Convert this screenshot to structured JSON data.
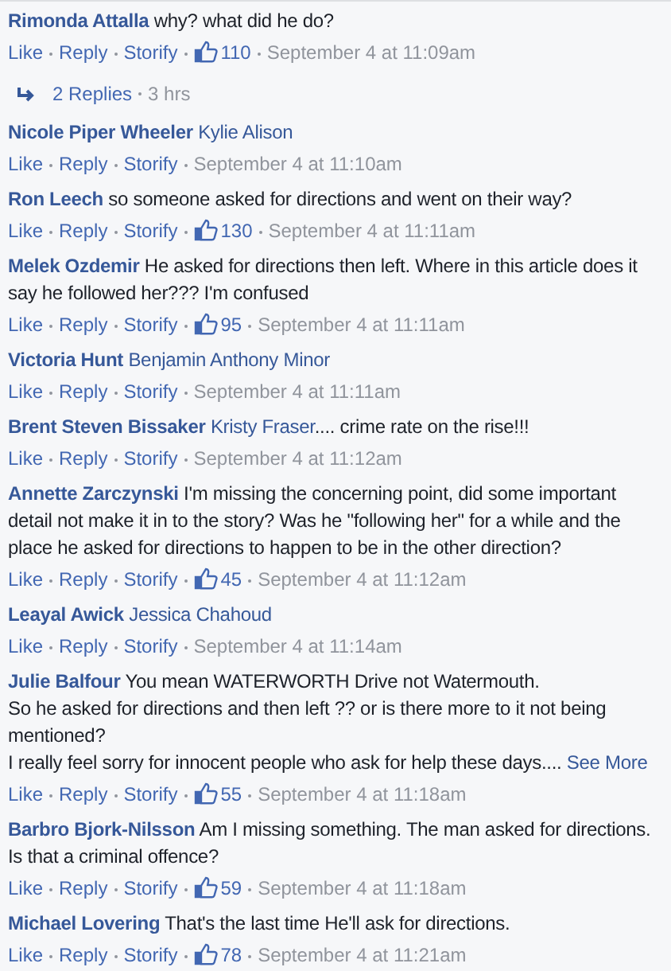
{
  "comments": [
    {
      "author": "Rimonda Attalla",
      "lines": [
        "why? what did he do?"
      ],
      "actions": [
        "Like",
        "Reply",
        "Storify"
      ],
      "likes": "110",
      "time": "September 4 at 11:09am",
      "replies": {
        "label": "2 Replies",
        "age": "3 hrs"
      }
    },
    {
      "author": "Nicole Piper Wheeler",
      "tag": "Kylie Alison",
      "actions": [
        "Like",
        "Reply",
        "Storify"
      ],
      "time": "September 4 at 11:10am"
    },
    {
      "author": "Ron Leech",
      "lines": [
        "so someone asked for directions and went on their way?"
      ],
      "actions": [
        "Like",
        "Reply",
        "Storify"
      ],
      "likes": "130",
      "time": "September 4 at 11:11am"
    },
    {
      "author": "Melek Ozdemir",
      "lines": [
        "He asked for directions then left. Where in this article does it say he followed her??? I'm confused"
      ],
      "actions": [
        "Like",
        "Reply",
        "Storify"
      ],
      "likes": "95",
      "time": "September 4 at 11:11am"
    },
    {
      "author": "Victoria Hunt",
      "tag": "Benjamin Anthony Minor",
      "actions": [
        "Like",
        "Reply",
        "Storify"
      ],
      "time": "September 4 at 11:11am"
    },
    {
      "author": "Brent Steven Bissaker",
      "tag": "Kristy Fraser",
      "lines": ".... crime rate on the rise!!!",
      "actions": [
        "Like",
        "Reply",
        "Storify"
      ],
      "time": "September 4 at 11:12am"
    },
    {
      "author": "Annette Zarczynski",
      "lines": [
        "I'm missing the concerning point, did some important detail not make it in to the story? Was he \"following her\" for a while and the place he asked for directions to happen to be in the other direction?"
      ],
      "actions": [
        "Like",
        "Reply",
        "Storify"
      ],
      "likes": "45",
      "time": "September 4 at 11:12am"
    },
    {
      "author": "Leayal Awick",
      "tag": "Jessica Chahoud",
      "actions": [
        "Like",
        "Reply",
        "Storify"
      ],
      "time": "September 4 at 11:14am"
    },
    {
      "author": "Julie Balfour",
      "lines": [
        "You mean WATERWORTH Drive not Watermouth.",
        "So he asked for directions and then left ?? or is there more to it not being mentioned?",
        "I really feel sorry for innocent people who ask for help these days...."
      ],
      "see_more": "See More",
      "actions": [
        "Like",
        "Reply",
        "Storify"
      ],
      "likes": "55",
      "time": "September 4 at 11:18am"
    },
    {
      "author": "Barbro Bjork-Nilsson",
      "lines": [
        "Am I missing something. The man asked for directions. Is that a criminal offence?"
      ],
      "actions": [
        "Like",
        "Reply",
        "Storify"
      ],
      "likes": "59",
      "time": "September 4 at 11:18am"
    },
    {
      "author": "Michael Lovering",
      "lines": [
        "That's the last time He'll ask for directions."
      ],
      "actions": [
        "Like",
        "Reply",
        "Storify"
      ],
      "likes": "78",
      "time": "September 4 at 11:21am"
    }
  ]
}
